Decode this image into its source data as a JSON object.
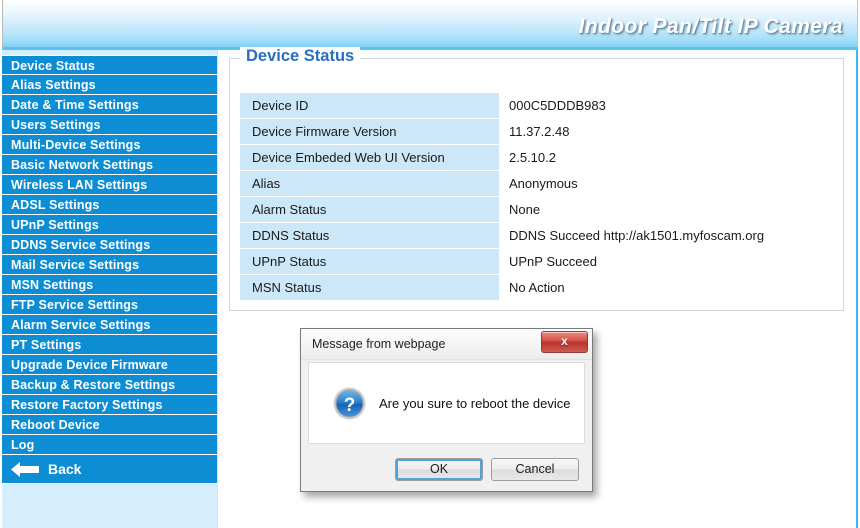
{
  "banner": {
    "title": "Indoor Pan/Tilt IP Camera"
  },
  "sidebar": {
    "items": [
      {
        "label": "Device Status",
        "name": "device-status"
      },
      {
        "label": "Alias Settings",
        "name": "alias-settings"
      },
      {
        "label": "Date & Time Settings",
        "name": "date-time-settings"
      },
      {
        "label": "Users Settings",
        "name": "users-settings"
      },
      {
        "label": "Multi-Device Settings",
        "name": "multi-device-settings"
      },
      {
        "label": "Basic Network Settings",
        "name": "basic-network-settings"
      },
      {
        "label": "Wireless LAN Settings",
        "name": "wireless-lan-settings"
      },
      {
        "label": "ADSL Settings",
        "name": "adsl-settings"
      },
      {
        "label": "UPnP Settings",
        "name": "upnp-settings"
      },
      {
        "label": "DDNS Service Settings",
        "name": "ddns-service-settings"
      },
      {
        "label": "Mail Service Settings",
        "name": "mail-service-settings"
      },
      {
        "label": "MSN Settings",
        "name": "msn-settings"
      },
      {
        "label": "FTP Service Settings",
        "name": "ftp-service-settings"
      },
      {
        "label": "Alarm Service Settings",
        "name": "alarm-service-settings"
      },
      {
        "label": "PT Settings",
        "name": "pt-settings"
      },
      {
        "label": "Upgrade Device Firmware",
        "name": "upgrade-device-firmware"
      },
      {
        "label": "Backup & Restore Settings",
        "name": "backup-restore-settings"
      },
      {
        "label": "Restore Factory Settings",
        "name": "restore-factory-settings"
      },
      {
        "label": "Reboot Device",
        "name": "reboot-device"
      },
      {
        "label": "Log",
        "name": "log"
      }
    ],
    "back_label": "Back",
    "back_icon": "left-arrow-icon"
  },
  "main": {
    "panel_title": "Device Status",
    "rows": [
      {
        "key": "Device ID",
        "value": "000C5DDDB983"
      },
      {
        "key": "Device Firmware Version",
        "value": "11.37.2.48"
      },
      {
        "key": "Device Embeded Web UI Version",
        "value": "2.5.10.2"
      },
      {
        "key": "Alias",
        "value": "Anonymous"
      },
      {
        "key": "Alarm Status",
        "value": "None"
      },
      {
        "key": "DDNS Status",
        "value": "DDNS Succeed  http://ak1501.myfoscam.org"
      },
      {
        "key": "UPnP Status",
        "value": "UPnP Succeed"
      },
      {
        "key": "MSN Status",
        "value": "No Action"
      }
    ]
  },
  "dialog": {
    "title": "Message from webpage",
    "message": "Are you sure to reboot the device",
    "icon": "question-mark-icon",
    "close_label": "x",
    "ok_label": "OK",
    "cancel_label": "Cancel"
  },
  "colors": {
    "nav_blue": "#0d8ed4",
    "banner_blue": "#7ed0f5",
    "legend_blue": "#2a6ec4",
    "row_key_bg": "#cce7f7",
    "accent_line": "#45b7ea",
    "close_red": "#d9534a"
  }
}
